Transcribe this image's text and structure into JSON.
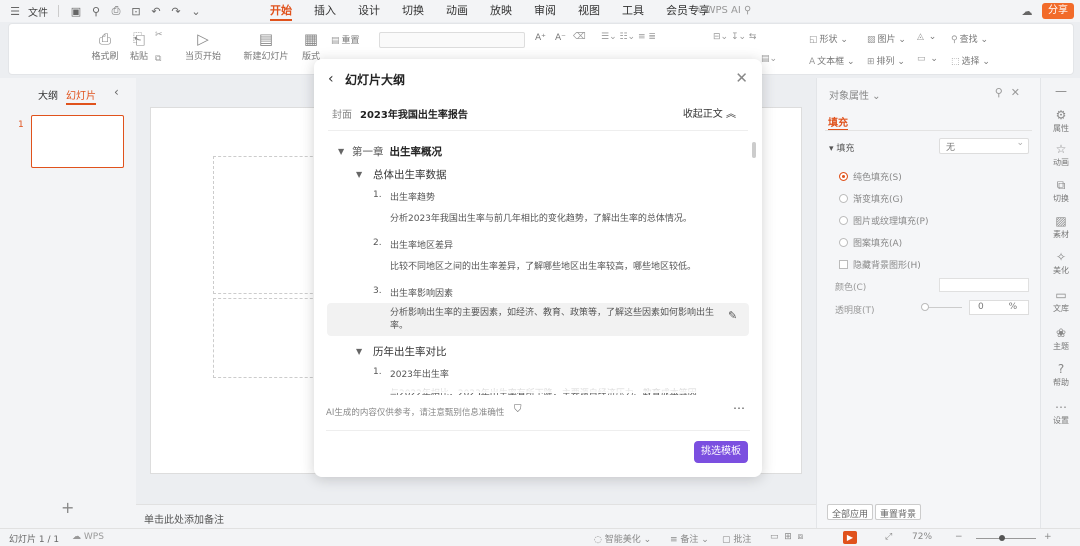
{
  "menubar": {
    "file": "文件",
    "tabs": [
      "开始",
      "插入",
      "设计",
      "切换",
      "动画",
      "放映",
      "审阅",
      "视图",
      "工具",
      "会员专享"
    ],
    "active_tab": "开始",
    "wps_ai": "WPS AI",
    "share": "分享"
  },
  "ribbon": {
    "format_painter": "格式刷",
    "paste": "粘贴",
    "from_current": "当页开始",
    "new_slide": "新建幻灯片",
    "layout": "版式",
    "reset": "重置",
    "font_grow": "A⁺",
    "font_shrink": "A⁻",
    "shape": "形状",
    "picture": "图片",
    "textbox": "文本框",
    "arrange": "排列",
    "find": "查找",
    "select": "选择"
  },
  "left_panel": {
    "tab_outline": "大纲",
    "tab_slides": "幻灯片",
    "slide_number": "1"
  },
  "notes_placeholder": "单击此处添加备注",
  "properties": {
    "title": "对象属性",
    "tab": "填充",
    "fill_label": "填充",
    "fill_value": "无",
    "options": [
      "纯色填充(S)",
      "渐变填充(G)",
      "图片或纹理填充(P)",
      "图案填充(A)"
    ],
    "selected_option": "纯色填充(S)",
    "hide_bg": "隐藏背景图形(H)",
    "color_label": "颜色(C)",
    "transparency_label": "透明度(T)",
    "transparency_value": "0",
    "transparency_unit": "%",
    "apply_all": "全部应用",
    "reset_bg": "重置背景"
  },
  "sidebar": [
    "属性",
    "动画",
    "切换",
    "素材",
    "美化",
    "文库",
    "主题",
    "帮助",
    "设置"
  ],
  "statusbar": {
    "slide_info": "幻灯片 1 / 1",
    "wps": "WPS",
    "smart_beautify": "智能美化",
    "notes": "备注",
    "comments": "批注",
    "zoom": "72%"
  },
  "dialog": {
    "title": "幻灯片大纲",
    "cover_label": "封面",
    "cover_title": "2023年我国出生率报告",
    "collapse": "收起正文",
    "chapter_label": "第一章",
    "chapter_title": "出生率概况",
    "section1": "总体出生率数据",
    "items": [
      {
        "num": "1.",
        "title": "出生率趋势",
        "desc": "分析2023年我国出生率与前几年相比的变化趋势，了解出生率的总体情况。"
      },
      {
        "num": "2.",
        "title": "出生率地区差异",
        "desc": "比较不同地区之间的出生率差异，了解哪些地区出生率较高，哪些地区较低。"
      },
      {
        "num": "3.",
        "title": "出生率影响因素",
        "desc": "分析影响出生率的主要因素，如经济、教育、政策等，了解这些因素如何影响出生率。"
      }
    ],
    "section2": "历年出生率对比",
    "item4_num": "1.",
    "item4_title": "2023年出生率",
    "item4_desc": "与2022年相比，2023年出生率有所下降，主要源自经济压力、教育成本等因",
    "disclaimer": "AI生成的内容仅供参考，请注意甄别信息准确性",
    "pick_template": "挑选模板"
  }
}
